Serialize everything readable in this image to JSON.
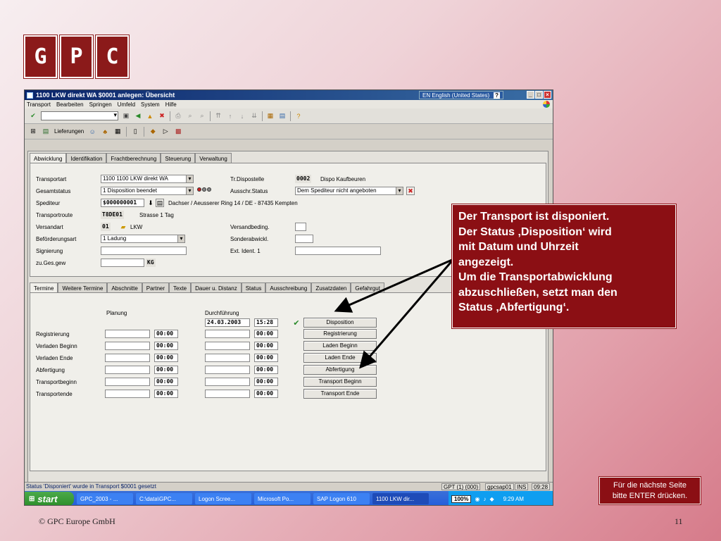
{
  "logo": [
    "G",
    "P",
    "C"
  ],
  "window": {
    "title": "1100 LKW direkt WA $0001 anlegen: Übersicht",
    "language": "EN English (United States)",
    "menu": [
      "Transport",
      "Bearbeiten",
      "Springen",
      "Umfeld",
      "System",
      "Hilfe"
    ],
    "toolbar2_label": "Lieferungen"
  },
  "top_tabs": [
    "Abwicklung",
    "Identifikation",
    "Frachtberechnung",
    "Steuerung",
    "Verwaltung"
  ],
  "header_fields": {
    "transportart_label": "Transportart",
    "transportart_value": "1100 1100 LKW direkt WA",
    "gesamtstatus_label": "Gesamtstatus",
    "gesamtstatus_value": "1 Disposition beendet",
    "spediteur_label": "Spediteur",
    "spediteur_value": "$000000001",
    "spediteur_address": "Dachser / Aeusserer Ring 14 / DE - 87435 Kempten",
    "transportroute_label": "Transportroute",
    "transportroute_value": "T8DE01",
    "transportroute_desc": "Strasse 1 Tag",
    "versandart_label": "Versandart",
    "versandart_value": "01",
    "versandart_desc": "LKW",
    "befoerderungsart_label": "Beförderungsart",
    "befoerderungsart_value": "1 Ladung",
    "signierung_label": "Signierung",
    "zugesgew_label": "zu.Ges.gew",
    "zugesgew_unit": "KG",
    "trdispo_label": "Tr.Dispostelle",
    "trdispo_value": "0002",
    "trdispo_desc": "Dispo  Kaufbeuren",
    "ausschr_label": "Ausschr.Status",
    "ausschr_value": "Dem Spediteur nicht angeboten",
    "versandbed_label": "Versandbeding.",
    "sonderabw_label": "Sonderabwickl.",
    "extident_label": "Ext. Ident. 1"
  },
  "bottom_tabs": [
    "Termine",
    "Weitere Termine",
    "Abschnitte",
    "Partner",
    "Texte",
    "Dauer u. Distanz",
    "Status",
    "Ausschreibung",
    "Zusatzdaten",
    "Gefahrgut"
  ],
  "termine": {
    "planung_label": "Planung",
    "durchfuehrung_label": "Durchführung",
    "disposition_date": "24.03.2003",
    "disposition_time": "15:28",
    "rows": [
      {
        "label": "Registrierung",
        "plan_time": "00:00",
        "done_time": "00:00",
        "button": "Registrierung"
      },
      {
        "label": "Verladen Beginn",
        "plan_time": "00:00",
        "done_time": "00:00",
        "button": "Laden Beginn"
      },
      {
        "label": "Verladen Ende",
        "plan_time": "00:00",
        "done_time": "00:00",
        "button": "Laden Ende"
      },
      {
        "label": "Abfertigung",
        "plan_time": "00:00",
        "done_time": "00:00",
        "button": "Abfertigung"
      },
      {
        "label": "Transportbeginn",
        "plan_time": "00:00",
        "done_time": "00:00",
        "button": "Transport Beginn"
      },
      {
        "label": "Transportende",
        "plan_time": "00:00",
        "done_time": "00:00",
        "button": "Transport Ende"
      }
    ],
    "disposition_button": "Disposition"
  },
  "statusbar": {
    "message": "Status 'Disponiert' wurde in Transport $0001 gesetzt",
    "system": "GPT (1) (000)",
    "server": "gpcsap01",
    "mode": "INS",
    "time": "09:28"
  },
  "taskbar": {
    "start": "start",
    "items": [
      "GPC_2003 - ...",
      "C:\\data\\GPC...",
      "Logon Scree...",
      "Microsoft Po...",
      "SAP Logon 610",
      "1100 LKW dir..."
    ],
    "zoom": "100%",
    "clock": "9:29 AM"
  },
  "callout": {
    "lines": [
      "Der Transport ist disponiert.",
      "Der Status ‚Disposition‘ wird",
      "mit Datum und Uhrzeit",
      "angezeigt.",
      "Um die Transportabwicklung",
      "abzuschließen, setzt man den",
      "Status ‚Abfertigung‘."
    ]
  },
  "hint": [
    "Für die nächste Seite",
    "bitte ENTER drücken."
  ],
  "footer": {
    "copyright": "© GPC Europe GmbH",
    "page": "11"
  },
  "colors": {
    "brand": "#8b1a1a",
    "callout": "#8b0f14"
  }
}
